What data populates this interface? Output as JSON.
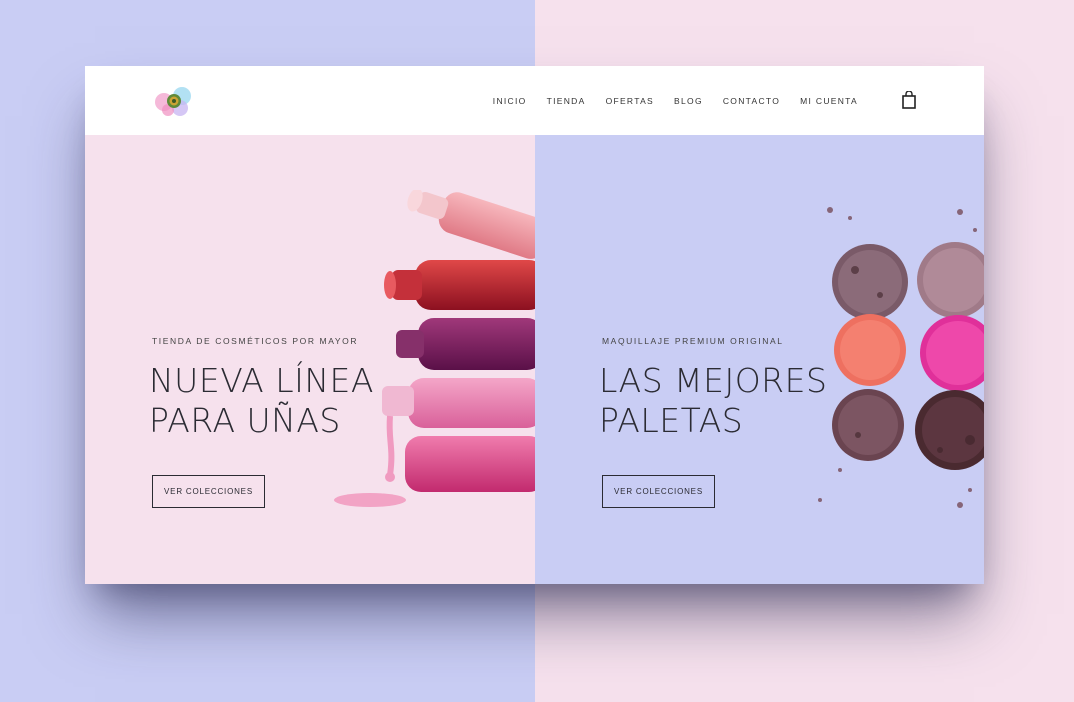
{
  "colors": {
    "lavender": "#c9cdf4",
    "pink": "#f6e1ed",
    "header_bg": "#ffffff",
    "text_dark": "#2b2b33"
  },
  "header": {
    "logo_icon": "watercolor-flower-logo",
    "nav": [
      "INICIO",
      "TIENDA",
      "OFERTAS",
      "BLOG",
      "CONTACTO",
      "MI CUENTA"
    ],
    "cart_icon": "shopping-bag-icon"
  },
  "hero_left": {
    "eyebrow": "TIENDA DE COSMÉTICOS POR MAYOR",
    "title_line1": "NUEVA LÍNEA",
    "title_line2": "PARA UÑAS",
    "button": "VER COLECCIONES",
    "image": "nail-polish-bottles"
  },
  "hero_right": {
    "eyebrow": "MAQUILLAJE PREMIUM ORIGINAL",
    "title_line1": "LAS MEJORES",
    "title_line2": "PALETAS",
    "button": "VER COLECCIONES",
    "image": "crushed-eyeshadow-pans"
  }
}
